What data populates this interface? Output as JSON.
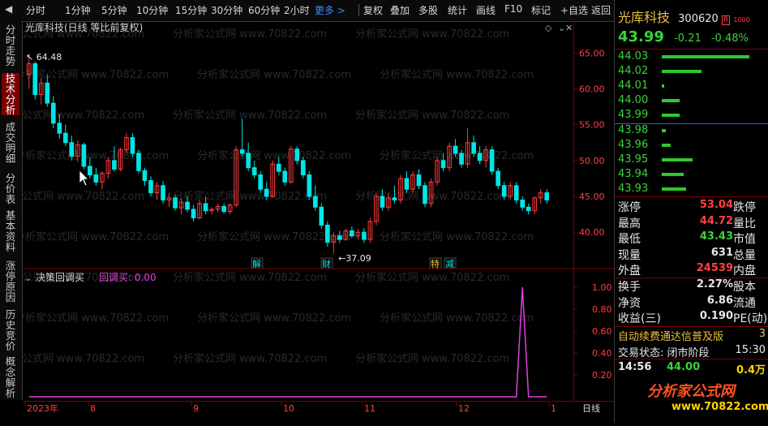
{
  "toolbar": {
    "back_arrow": "◀",
    "items": [
      "分时",
      "1分钟",
      "5分钟",
      "10分钟",
      "15分钟",
      "30分钟",
      "60分钟",
      "2小时"
    ],
    "more": "更多 >",
    "right_items": [
      "复权",
      "叠加",
      "多股",
      "统计",
      "画线",
      "F10",
      "标记",
      "+自选",
      "返回"
    ]
  },
  "left_tabs": [
    "分时走势",
    "技术分析",
    "成交明细",
    "分价表",
    "基本资料",
    "涨停原因",
    "历史竞价",
    "概念解析"
  ],
  "left_tab_active": 1,
  "chart": {
    "title": "光库科技(日线 等比前复权)",
    "high_marker": "64.48",
    "low_marker": "37.09",
    "badges": [
      "解",
      "财",
      "特",
      "减"
    ],
    "watermark": "分析家公式网 www.70822.com",
    "price_ticks": [
      "65.00",
      "60.00",
      "55.00",
      "50.00",
      "45.00",
      "40.00"
    ],
    "indicator_name": "决策回调买",
    "indicator_label": "回调买: 0.00",
    "indicator_ticks": [
      "1.00",
      "0.80",
      "0.60",
      "0.40",
      "0.20"
    ],
    "date_labels": [
      "2023年",
      "8",
      "9",
      "10",
      "11",
      "12",
      "1"
    ],
    "day_label": "日线",
    "colors": {
      "up": "#ff3c3c",
      "down": "#00e5e5",
      "indicator": "#e040e0",
      "axis": "#7a0000"
    }
  },
  "chart_data": {
    "type": "candlestick",
    "price_range": [
      35.5,
      66.5
    ],
    "candles": [
      [
        62.0,
        64.48,
        60.0,
        63.5
      ],
      [
        63.5,
        63.8,
        58.5,
        59.2
      ],
      [
        59.2,
        61.5,
        57.8,
        60.8
      ],
      [
        60.8,
        62.0,
        57.5,
        58.0
      ],
      [
        58.0,
        59.0,
        54.5,
        55.2
      ],
      [
        55.2,
        56.5,
        53.0,
        53.8
      ],
      [
        53.8,
        55.0,
        52.0,
        52.5
      ],
      [
        52.5,
        53.5,
        50.0,
        50.6
      ],
      [
        50.6,
        52.8,
        49.8,
        52.2
      ],
      [
        52.2,
        52.5,
        48.8,
        49.2
      ],
      [
        49.2,
        50.5,
        47.5,
        48.0
      ],
      [
        48.0,
        49.0,
        46.5,
        47.0
      ],
      [
        47.0,
        48.5,
        46.0,
        48.2
      ],
      [
        48.2,
        50.5,
        47.5,
        50.0
      ],
      [
        50.0,
        52.0,
        48.5,
        48.8
      ],
      [
        48.8,
        51.8,
        48.5,
        51.5
      ],
      [
        51.5,
        53.8,
        51.0,
        53.2
      ],
      [
        53.2,
        53.8,
        50.5,
        51.0
      ],
      [
        51.0,
        51.5,
        48.2,
        48.6
      ],
      [
        48.6,
        49.0,
        46.5,
        47.2
      ],
      [
        47.2,
        47.8,
        45.0,
        45.5
      ],
      [
        45.5,
        47.0,
        44.5,
        46.5
      ],
      [
        46.5,
        47.2,
        44.0,
        44.5
      ],
      [
        44.5,
        45.5,
        43.5,
        44.8
      ],
      [
        44.8,
        45.2,
        43.0,
        43.4
      ],
      [
        43.4,
        44.8,
        42.5,
        44.2
      ],
      [
        44.2,
        45.0,
        42.8,
        43.2
      ],
      [
        43.2,
        43.8,
        41.5,
        42.0
      ],
      [
        42.0,
        44.5,
        41.8,
        44.0
      ],
      [
        44.0,
        45.0,
        42.5,
        43.0
      ],
      [
        43.0,
        43.5,
        42.5,
        43.2
      ],
      [
        43.2,
        44.0,
        42.8,
        43.6
      ],
      [
        43.6,
        44.0,
        42.6,
        42.9
      ],
      [
        42.9,
        44.0,
        42.5,
        43.8
      ],
      [
        43.8,
        52.0,
        43.5,
        51.5
      ],
      [
        51.5,
        55.8,
        50.5,
        51.0
      ],
      [
        51.0,
        52.5,
        48.5,
        49.0
      ],
      [
        49.0,
        50.0,
        47.5,
        48.0
      ],
      [
        48.0,
        48.5,
        45.5,
        46.0
      ],
      [
        46.0,
        47.0,
        44.5,
        45.0
      ],
      [
        45.0,
        50.0,
        44.8,
        49.5
      ],
      [
        49.5,
        50.5,
        48.0,
        48.5
      ],
      [
        48.5,
        49.0,
        46.5,
        47.0
      ],
      [
        47.0,
        52.0,
        46.8,
        51.6
      ],
      [
        51.6,
        52.0,
        49.5,
        50.0
      ],
      [
        50.0,
        50.5,
        47.5,
        48.0
      ],
      [
        48.0,
        48.5,
        44.5,
        45.0
      ],
      [
        45.0,
        46.5,
        43.0,
        43.5
      ],
      [
        43.5,
        44.0,
        40.5,
        41.0
      ],
      [
        41.0,
        41.5,
        38.0,
        38.6
      ],
      [
        38.6,
        40.0,
        37.09,
        39.5
      ],
      [
        39.5,
        40.2,
        38.5,
        39.0
      ],
      [
        39.0,
        40.5,
        38.8,
        40.2
      ],
      [
        40.2,
        40.8,
        39.2,
        39.5
      ],
      [
        39.5,
        40.5,
        39.0,
        40.0
      ],
      [
        40.0,
        40.6,
        38.5,
        39.0
      ],
      [
        39.0,
        42.0,
        38.5,
        41.5
      ],
      [
        41.5,
        45.5,
        41.0,
        45.0
      ],
      [
        45.0,
        46.0,
        43.0,
        43.5
      ],
      [
        43.5,
        45.5,
        43.0,
        44.8
      ],
      [
        44.8,
        46.5,
        44.0,
        44.5
      ],
      [
        44.5,
        48.0,
        44.0,
        47.5
      ],
      [
        47.5,
        48.5,
        45.5,
        46.0
      ],
      [
        46.0,
        48.5,
        45.5,
        48.0
      ],
      [
        48.0,
        48.8,
        46.0,
        46.5
      ],
      [
        46.5,
        47.0,
        43.5,
        44.0
      ],
      [
        44.0,
        47.5,
        43.5,
        47.0
      ],
      [
        47.0,
        50.5,
        46.5,
        50.0
      ],
      [
        50.0,
        51.0,
        48.5,
        49.0
      ],
      [
        49.0,
        52.5,
        48.5,
        52.0
      ],
      [
        52.0,
        53.0,
        50.5,
        51.0
      ],
      [
        51.0,
        51.5,
        49.0,
        49.5
      ],
      [
        49.5,
        54.5,
        49.0,
        52.5
      ],
      [
        52.5,
        53.5,
        50.5,
        51.0
      ],
      [
        51.0,
        52.0,
        49.5,
        50.0
      ],
      [
        50.0,
        52.0,
        49.0,
        51.5
      ],
      [
        51.5,
        52.0,
        48.0,
        48.5
      ],
      [
        48.5,
        49.0,
        46.0,
        46.5
      ],
      [
        46.5,
        47.0,
        44.5,
        45.0
      ],
      [
        45.0,
        47.0,
        44.5,
        46.5
      ],
      [
        46.5,
        47.0,
        44.0,
        44.5
      ],
      [
        44.5,
        45.0,
        43.0,
        43.5
      ],
      [
        43.5,
        44.0,
        42.5,
        43.0
      ],
      [
        43.0,
        45.0,
        42.5,
        44.8
      ],
      [
        44.8,
        46.0,
        44.0,
        45.5
      ],
      [
        45.5,
        46.0,
        44.0,
        44.5
      ]
    ],
    "indicator_values_peak_index": 81,
    "indicator_peak": 1.0
  },
  "quote": {
    "name": "光库科技",
    "code": "300620",
    "code_tag": "R",
    "price": "43.99",
    "change": "-0.21",
    "change_pct": "-0.48%",
    "asks": [
      {
        "price": "44.03",
        "bar": 1.0
      },
      {
        "price": "44.02",
        "bar": 0.45
      },
      {
        "price": "44.01",
        "bar": 0.03
      },
      {
        "price": "44.00",
        "bar": 0.2
      },
      {
        "price": "43.99",
        "bar": 0.2
      }
    ],
    "bids": [
      {
        "price": "43.98",
        "bar": 0.05
      },
      {
        "price": "43.96",
        "bar": 0.1
      },
      {
        "price": "43.95",
        "bar": 0.35
      },
      {
        "price": "43.94",
        "bar": 0.25
      },
      {
        "price": "43.93",
        "bar": 0.28
      }
    ],
    "stats": [
      {
        "l": "涨停",
        "v": "53.04",
        "vc": "red",
        "r": "跌停"
      },
      {
        "l": "最高",
        "v": "44.72",
        "vc": "red",
        "r": "量比"
      },
      {
        "l": "最低",
        "v": "43.43",
        "vc": "green",
        "r": "市值"
      },
      {
        "l": "现量",
        "v": "631",
        "vc": "white",
        "r": "总量"
      },
      {
        "l": "外盘",
        "v": "24539",
        "vc": "red",
        "r": "内盘"
      }
    ],
    "stats2": [
      {
        "l": "换手",
        "v": "2.27%",
        "vc": "white",
        "r": "股本"
      },
      {
        "l": "净资",
        "v": "6.86",
        "vc": "white",
        "r": "流通"
      },
      {
        "l": "收益(三)",
        "v": "0.190",
        "vc": "white",
        "r": "PE(动)"
      }
    ],
    "notice": "自动续费通达信普及版",
    "notice_num": "3",
    "trade_state_label": "交易状态:",
    "trade_state": "闭市阶段",
    "trade_time": "15:30",
    "tick": {
      "time": "14:56",
      "price": "44.00",
      "vol": "0.4万"
    },
    "logo_text": "分析家公式网",
    "logo_url": "www.70822.com"
  }
}
